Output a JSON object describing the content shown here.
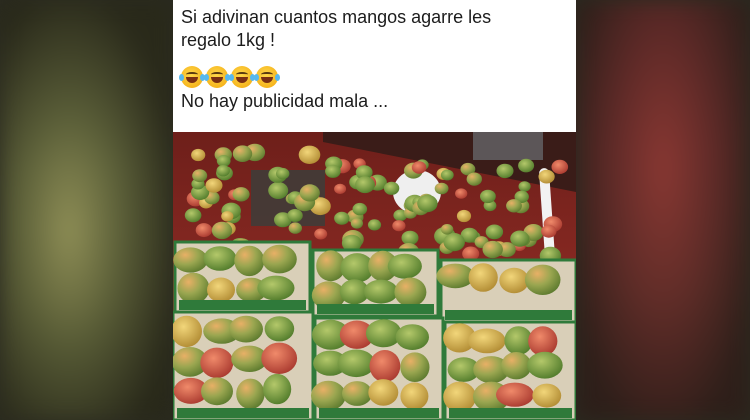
{
  "post": {
    "caption_line1": "Si adivinan cuantos mangos agarre les",
    "caption_line2": "regalo 1kg !",
    "emojis": [
      "rolling-on-floor-laughing-emoji",
      "joy-emoji",
      "rolling-on-floor-laughing-emoji",
      "joy-emoji"
    ],
    "caption_line3": "No hay publicidad mala ..."
  },
  "photo": {
    "subject": "mangos-in-truck-bed-icon"
  },
  "colors": {
    "truck_red": "#8e2a24",
    "mango_green": "#6f9a3a",
    "mango_red": "#c9453a",
    "mango_yellow": "#d9b24a",
    "box_white": "#e9e4d8",
    "box_green": "#2f7a3a"
  }
}
